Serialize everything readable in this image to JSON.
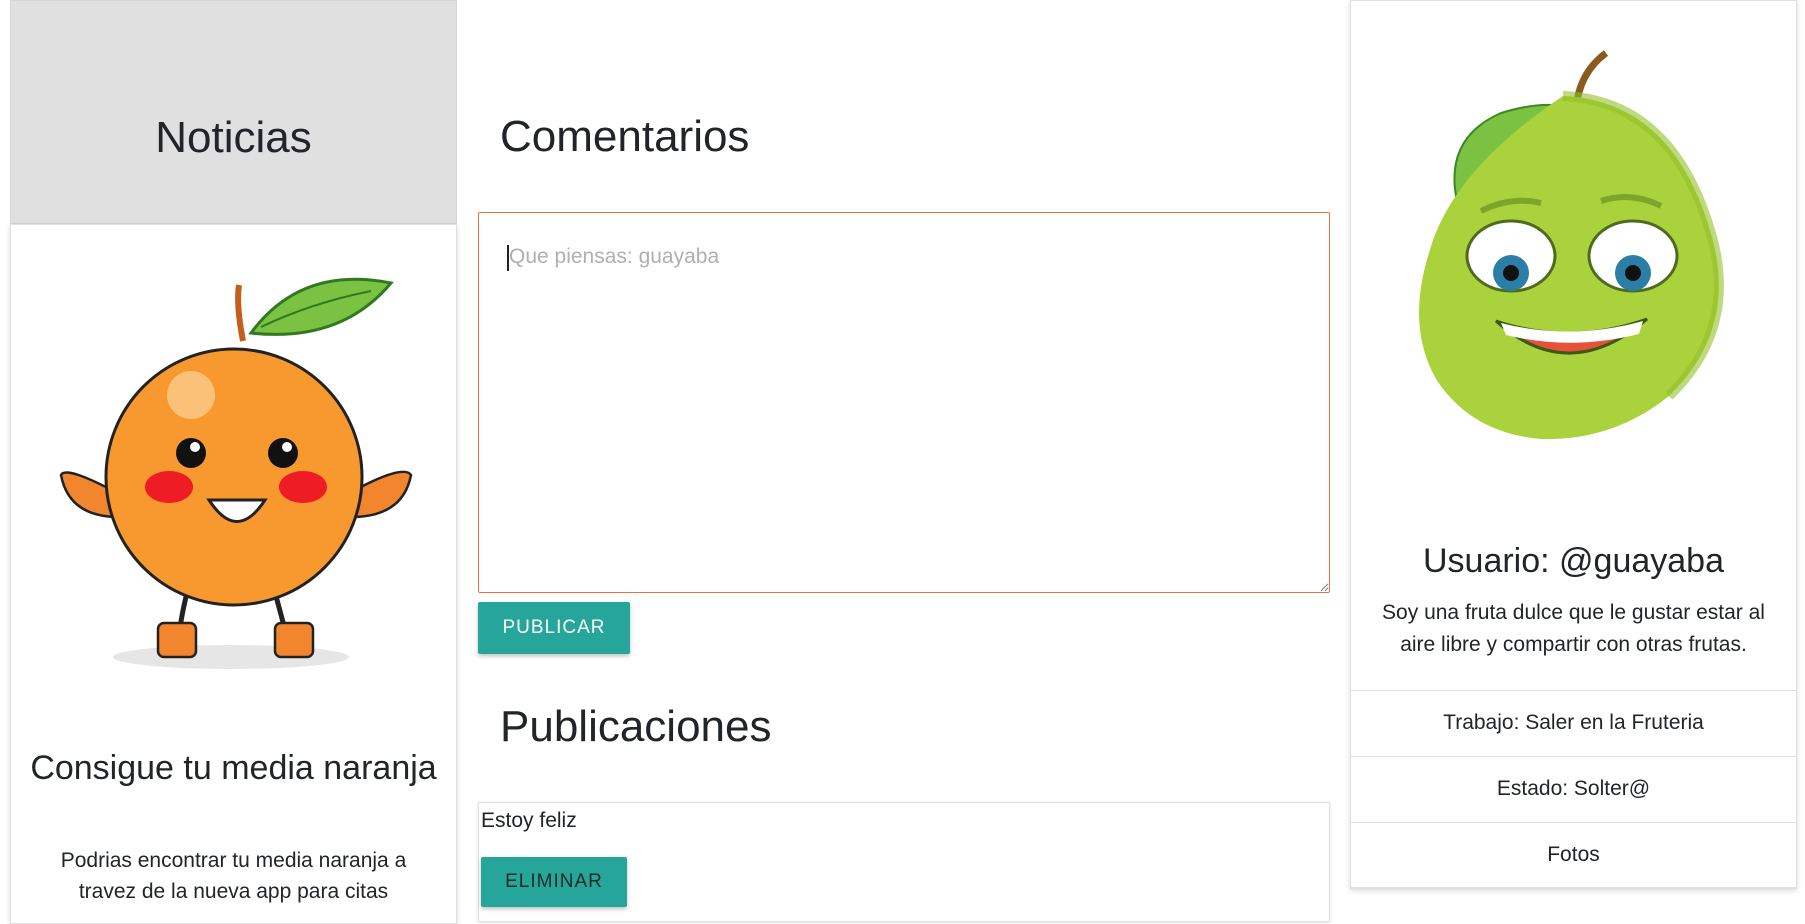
{
  "news": {
    "title": "Noticias",
    "card_title": "Consigue tu media naranja",
    "card_text": "Podrias encontrar tu media naranja a travez de la nueva app para citas"
  },
  "comments": {
    "title": "Comentarios",
    "placeholder": "Que piensas: guayaba",
    "publish_label": "PUBLICAR"
  },
  "posts": {
    "title": "Publicaciones",
    "items": [
      {
        "text": "Estoy feliz",
        "delete_label": "ELIMINAR"
      }
    ]
  },
  "profile": {
    "user": "Usuario: @guayaba",
    "bio": "Soy una fruta dulce que le gustar estar al aire libre y compartir con otras frutas.",
    "work": "Trabajo: Saler en la Fruteria",
    "state": "Estado: Solter@",
    "photos": "Fotos"
  },
  "colors": {
    "accent": "#26a69a",
    "focus_border": "#e5753c",
    "header_bg": "#e0e0e0"
  }
}
